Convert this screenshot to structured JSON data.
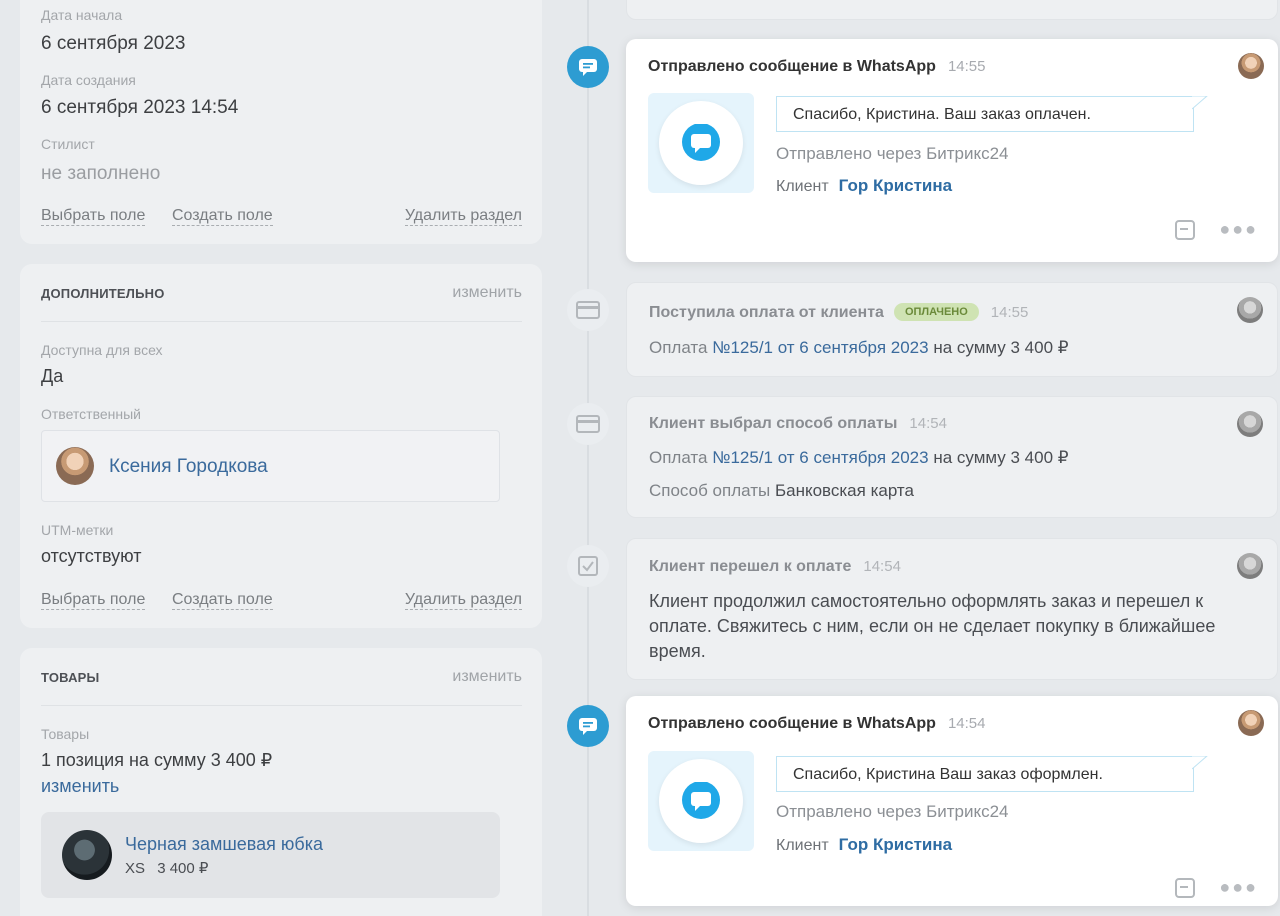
{
  "left": {
    "card1": {
      "fields": [
        {
          "label": "Дата начала",
          "value": "6 сентября 2023"
        },
        {
          "label": "Дата создания",
          "value": "6 сентября 2023 14:54"
        },
        {
          "label": "Стилист",
          "value": "не заполнено"
        }
      ],
      "links": {
        "select_field": "Выбрать поле",
        "create_field": "Создать поле",
        "delete_section": "Удалить раздел"
      }
    },
    "card2": {
      "title": "ДОПОЛНИТЕЛЬНО",
      "edit": "изменить",
      "available_label": "Доступна для всех",
      "available_value": "Да",
      "responsible_label": "Ответственный",
      "responsible_name": "Ксения Городкова",
      "utm_label": "UTM-метки",
      "utm_value": "отсутствуют",
      "links": {
        "select_field": "Выбрать поле",
        "create_field": "Создать поле",
        "delete_section": "Удалить раздел"
      }
    },
    "card3": {
      "title": "ТОВАРЫ",
      "edit": "изменить",
      "goods_label": "Товары",
      "goods_summary": "1 позиция на сумму 3 400 ₽",
      "goods_edit": "изменить",
      "product": {
        "name": "Черная замшевая юбка",
        "size": "XS",
        "price": "3 400 ₽"
      }
    }
  },
  "timeline": {
    "events": [
      {
        "title": "Отправлено сообщение в WhatsApp",
        "time": "14:55",
        "message": "Спасибо, Кристина. Ваш заказ оплачен.",
        "via": "Отправлено через Битрикс24",
        "client_label": "Клиент",
        "client_name": "Гор Кристина"
      },
      {
        "title": "Поступила оплата от клиента",
        "badge": "ОПЛАЧЕНО",
        "time": "14:55",
        "line_prefix": "Оплата",
        "line_link": "№125/1 от 6 сентября 2023",
        "line_suffix": "на сумму 3 400 ₽"
      },
      {
        "title": "Клиент выбрал способ оплаты",
        "time": "14:54",
        "line_prefix": "Оплата",
        "line_link": "№125/1 от 6 сентября 2023",
        "line_suffix": "на сумму 3 400 ₽",
        "method_label": "Способ оплаты",
        "method_value": "Банковская карта"
      },
      {
        "title": "Клиент перешел к оплате",
        "time": "14:54",
        "text": "Клиент продолжил самостоятельно оформлять заказ и перешел к оплате. Свяжитесь с ним, если он не сделает покупку в ближайшее время."
      },
      {
        "title": "Отправлено сообщение в WhatsApp",
        "time": "14:54",
        "message": "Спасибо, Кристина Ваш заказ оформлен.",
        "via": "Отправлено через Битрикс24",
        "client_label": "Клиент",
        "client_name": "Гор Кристина"
      }
    ]
  },
  "colors": {
    "accent": "#2d9cd2",
    "link": "#2e6ca3",
    "badge_bg": "#cfe3b3",
    "badge_text": "#6b8a3a"
  },
  "icons": [
    "chat-icon",
    "credit-card-icon",
    "checkbox-icon",
    "message-bubble-icon",
    "note-icon",
    "more-icon"
  ]
}
